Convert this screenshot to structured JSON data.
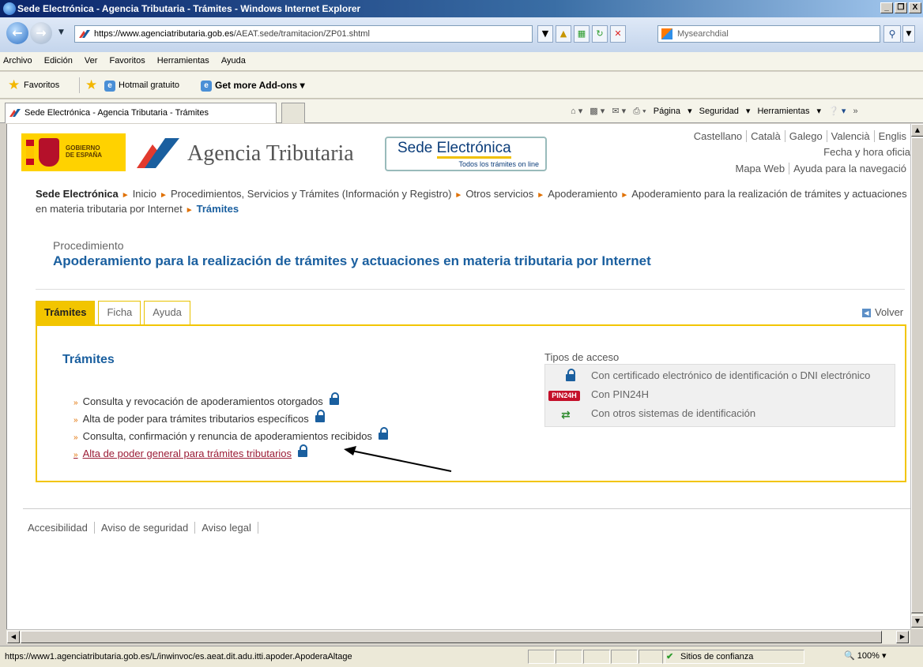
{
  "window": {
    "title": "Sede Electrónica - Agencia Tributaria - Trámites - Windows Internet Explorer",
    "controls": [
      "_",
      "❐",
      "X"
    ]
  },
  "address": {
    "url_host": "https://www.agenciatributaria.gob.es",
    "url_path": "/AEAT.sede/tramitacion/ZP01.shtml",
    "search_placeholder": "Mysearchdial"
  },
  "menu": [
    "Archivo",
    "Edición",
    "Ver",
    "Favoritos",
    "Herramientas",
    "Ayuda"
  ],
  "favorites_bar": {
    "favoritos": "Favoritos",
    "hotmail": "Hotmail gratuito",
    "addons": "Get more Add-ons"
  },
  "tab": {
    "title": "Sede Electrónica - Agencia Tributaria - Trámites"
  },
  "commands": {
    "pagina": "Página",
    "seguridad": "Seguridad",
    "herramientas": "Herramientas"
  },
  "page": {
    "languages": [
      "Castellano",
      "Català",
      "Galego",
      "Valencià",
      "Englis"
    ],
    "fecha": "Fecha y hora oficia",
    "mapa_web": "Mapa Web",
    "ayuda_nav": "Ayuda para la navegació",
    "gobierno": "GOBIERNO\nDE ESPAÑA",
    "agencia": "Agencia Tributaria",
    "sede_a": "Sede ",
    "sede_b": "Electrónica",
    "sede_tagline": "Todos los trámites on line",
    "breadcrumb": [
      "Sede Electrónica",
      "Inicio",
      "Procedimientos, Servicios y Trámites (Información y Registro)",
      "Otros servicios",
      "Apoderamiento",
      "Apoderamiento para la realización de trámites y actuaciones en materia tributaria por Internet",
      "Trámites"
    ],
    "proc_label": "Procedimiento",
    "proc_title": "Apoderamiento para la realización de trámites y actuaciones en materia tributaria por Internet",
    "tabs": [
      "Trámites",
      "Ficha",
      "Ayuda"
    ],
    "volver": "Volver",
    "panel_title": "Trámites",
    "tramites": [
      "Consulta y revocación de apoderamientos otorgados",
      "Alta de poder para trámites tributarios específicos",
      "Consulta, confirmación y renuncia de apoderamientos recibidos",
      "Alta de poder general para trámites tributarios"
    ],
    "tipos_acceso_label": "Tipos de acceso",
    "accesos": [
      "Con certificado electrónico de identificación o DNI electrónico",
      "Con PIN24H",
      "Con otros sistemas de identificación"
    ],
    "pin_badge": "PIN24H",
    "footer": [
      "Accesibilidad",
      "Aviso de seguridad",
      "Aviso legal"
    ]
  },
  "status": {
    "url": "https://www1.agenciatributaria.gob.es/L/inwinvoc/es.aeat.dit.adu.itti.apoder.ApoderaAltage",
    "zone": "Sitios de confianza",
    "zoom": "100%"
  }
}
